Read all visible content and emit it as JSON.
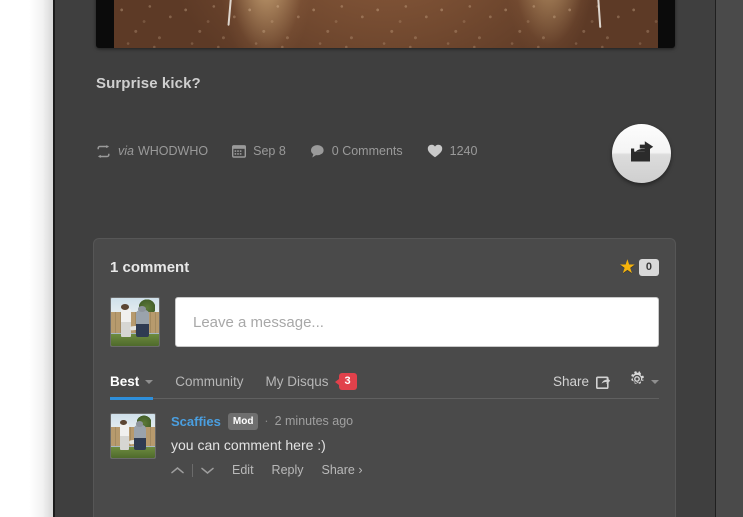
{
  "post": {
    "title": "Surprise kick?",
    "hero_alt": "horse-photo",
    "meta": {
      "via_label": "via",
      "via_source": "WHODWHO",
      "date": "Sep 8",
      "comments": "0 Comments",
      "likes": "1240"
    },
    "share_button_label": "share-post"
  },
  "disqus": {
    "comment_count_label": "1 comment",
    "favorite_count": "0",
    "composer": {
      "placeholder": "Leave a message...",
      "value": ""
    },
    "tabs": [
      {
        "label": "Best",
        "active": true,
        "has_caret": true,
        "badge": ""
      },
      {
        "label": "Community",
        "active": false,
        "has_caret": false,
        "badge": ""
      },
      {
        "label": "My Disqus",
        "active": false,
        "has_caret": false,
        "badge": "3"
      }
    ],
    "share_label": "Share",
    "settings_label": "settings",
    "comments": [
      {
        "author": "Scaffies",
        "badge": "Mod",
        "separator": "·",
        "timestamp": "2 minutes ago",
        "text": "you can comment here :)",
        "actions": [
          "Edit",
          "Reply",
          "Share ›"
        ]
      }
    ]
  },
  "colors": {
    "page_bg": "#3f3f3f",
    "panel_bg": "#4a4a4a",
    "accent_blue": "#2e8fdb",
    "author_blue": "#4a9fe0",
    "badge_red": "#e1414b",
    "star_gold": "#f5b30c"
  }
}
